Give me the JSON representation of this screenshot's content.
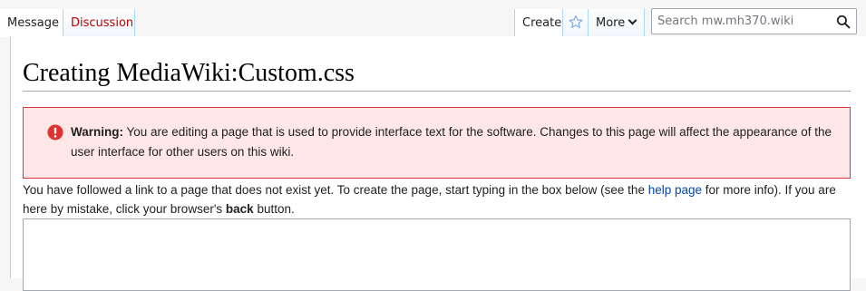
{
  "tabs": {
    "message": "Message",
    "discussion": "Discussion",
    "create": "Create",
    "more": "More"
  },
  "search": {
    "placeholder": "Search mw.mh370.wiki",
    "icon": "magnifier-icon"
  },
  "page": {
    "title": "Creating MediaWiki:Custom.css"
  },
  "warning": {
    "label": "Warning:",
    "text": " You are editing a page that is used to provide interface text for the software. Changes to this page will affect the appearance of the user interface for other users on this wiki.",
    "icon": "error-icon"
  },
  "intro": {
    "part1": "You have followed a link to a page that does not exist yet. To create the page, start typing in the box below (see the ",
    "help_link": "help page",
    "part2": " for more info). If you are here by mistake, click your browser's ",
    "back": "back",
    "part3": " button."
  },
  "editor": {
    "value": ""
  },
  "colors": {
    "link": "#0645ad",
    "red_link": "#ba0000",
    "tab_border": "#a7d7f9",
    "warning_bg": "#fee7e6",
    "warning_border": "#dd3333",
    "error_icon": "#dd3333"
  }
}
